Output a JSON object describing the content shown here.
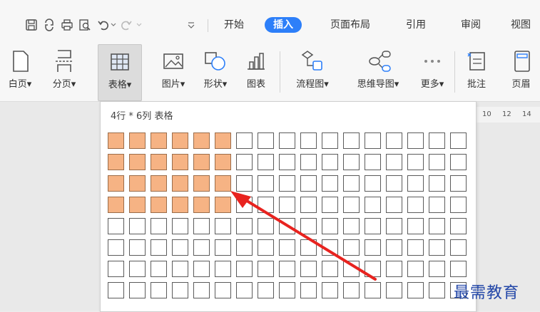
{
  "menu": {
    "tabs": [
      {
        "label": "开始",
        "active": false
      },
      {
        "label": "插入",
        "active": true
      },
      {
        "label": "页面布局",
        "active": false
      },
      {
        "label": "引用",
        "active": false
      },
      {
        "label": "审阅",
        "active": false
      },
      {
        "label": "视图",
        "active": false
      }
    ]
  },
  "quick_access": {
    "icons": [
      "save-icon",
      "convert-icon",
      "print-icon",
      "print-preview-icon",
      "undo-icon",
      "undo-dropdown-icon",
      "redo-icon",
      "customize-icon"
    ]
  },
  "ribbon": {
    "blank_page_label": "白页",
    "page_break_label": "分页",
    "table_label": "表格",
    "picture_label": "图片",
    "shape_label": "形状",
    "chart_label": "图表",
    "flowchart_label": "流程图",
    "mindmap_label": "思维导图",
    "more_label": "更多",
    "comment_label": "批注",
    "header_label": "页眉"
  },
  "dropdown": {
    "title": "4行 * 6列 表格",
    "rows": 8,
    "cols": 17,
    "selected_rows": 4,
    "selected_cols": 6,
    "selection_color": "#f6b384"
  },
  "ruler": {
    "ticks": [
      "10",
      "12",
      "14"
    ]
  },
  "annotation": {
    "arrow_color": "#e8231f"
  },
  "watermark": {
    "text": "最需教育"
  },
  "colors": {
    "accent": "#2d7ff9"
  }
}
